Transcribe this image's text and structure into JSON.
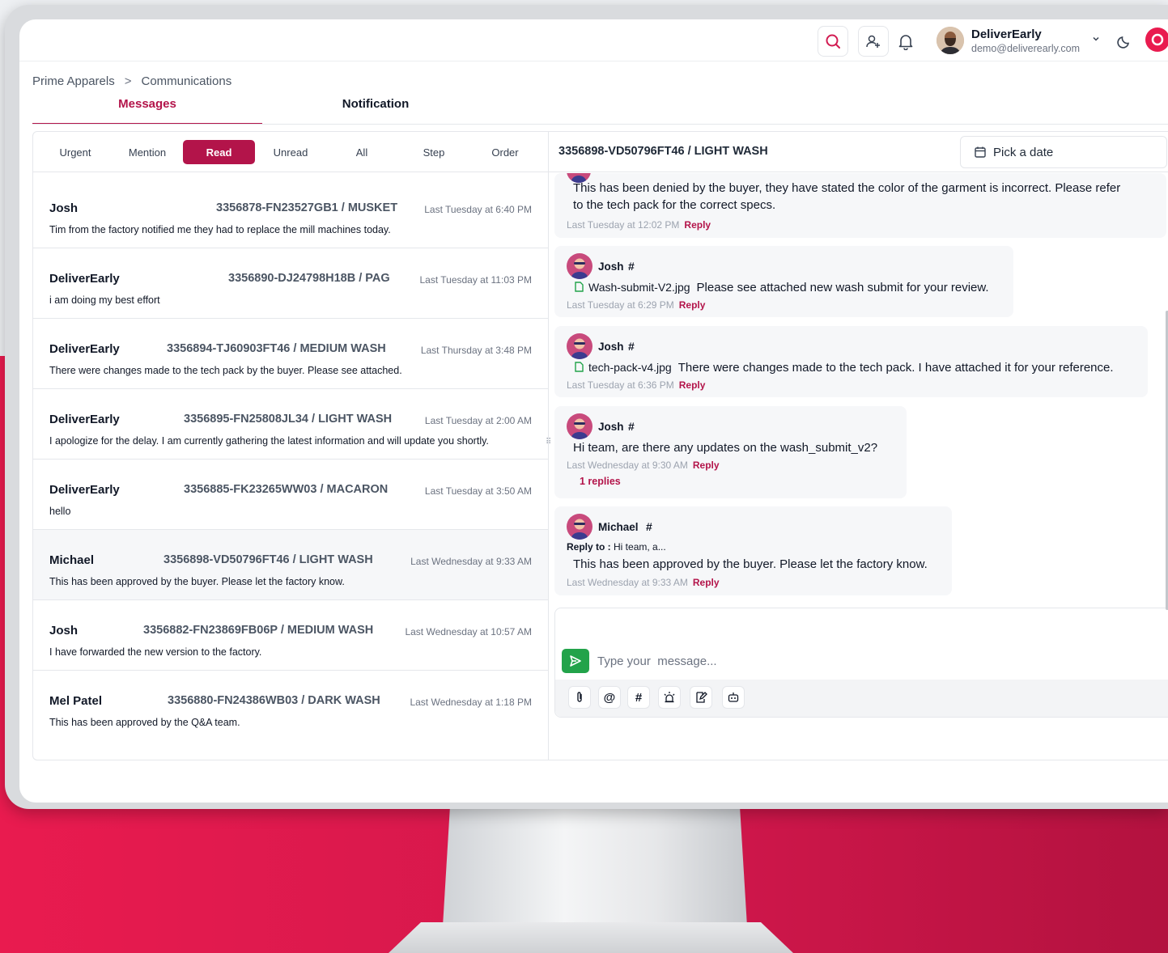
{
  "topbar": {
    "user_name": "DeliverEarly",
    "user_email": "demo@deliverearly.com"
  },
  "breadcrumb": {
    "items": [
      "Prime Apparels",
      "Communications"
    ],
    "separator": ">"
  },
  "tabs": [
    {
      "label": "Messages",
      "active": true
    },
    {
      "label": "Notification",
      "active": false
    }
  ],
  "filters": [
    {
      "label": "Urgent",
      "active": false
    },
    {
      "label": "Mention",
      "active": false
    },
    {
      "label": "Read",
      "active": true
    },
    {
      "label": "Unread",
      "active": false
    },
    {
      "label": "All",
      "active": false
    },
    {
      "label": "Step",
      "active": false
    },
    {
      "label": "Order",
      "active": false
    }
  ],
  "conversations": [
    {
      "name": "Josh",
      "order": "3356878-FN23527GB1 / MUSKET",
      "time": "Last Tuesday at 6:40 PM",
      "text": "Tim from the factory notified me they had to replace the mill machines today."
    },
    {
      "name": "DeliverEarly",
      "order": "3356890-DJ24798H18B / PAG",
      "time": "Last Tuesday at 11:03 PM",
      "text": "i am doing my best effort"
    },
    {
      "name": "DeliverEarly",
      "order": "3356894-TJ60903FT46 / MEDIUM WASH",
      "time": "Last Thursday at 3:48 PM",
      "text": "There were changes made to the tech pack by the buyer. Please see attached."
    },
    {
      "name": "DeliverEarly",
      "order": "3356895-FN25808JL34 / LIGHT WASH",
      "time": "Last Tuesday at 2:00 AM",
      "text": "I apologize for the delay. I am currently gathering the latest information and will update you shortly."
    },
    {
      "name": "DeliverEarly",
      "order": "3356885-FK23265WW03 / MACARON",
      "time": "Last Tuesday at 3:50 AM",
      "text": "hello"
    },
    {
      "name": "Michael",
      "order": "3356898-VD50796FT46 / LIGHT WASH",
      "time": "Last Wednesday at 9:33 AM",
      "text": "This has been approved by the buyer. Please let the factory know."
    },
    {
      "name": "Josh",
      "order": "3356882-FN23869FB06P / MEDIUM WASH",
      "time": "Last Wednesday at 10:57 AM",
      "text": "I have forwarded the new version to the factory."
    },
    {
      "name": "Mel Patel",
      "order": "3356880-FN24386WB03 / DARK WASH",
      "time": "Last Wednesday at 1:18 PM",
      "text": "This has been approved by the Q&A team."
    }
  ],
  "thread": {
    "title": "3356898-VD50796FT46 / LIGHT WASH",
    "date_placeholder": "Pick a date",
    "messages": [
      {
        "body_line1": "This has been denied by the buyer, they have stated the color of the garment is incorrect. Please refer",
        "body_line2": "to the tech pack for the correct specs.",
        "meta": "Last Tuesday at 12:02 PM",
        "reply": "Reply"
      },
      {
        "author": "Josh",
        "hash": "#",
        "file": "Wash-submit-V2.jpg",
        "body": "Please see attached new wash submit for your review.",
        "meta": "Last Tuesday at 6:29 PM",
        "reply": "Reply"
      },
      {
        "author": "Josh",
        "hash": "#",
        "file": "tech-pack-v4.jpg",
        "body": "There were changes made to the tech pack. I have attached it for your reference.",
        "meta": "Last Tuesday at 6:36 PM",
        "reply": "Reply"
      },
      {
        "author": "Josh",
        "hash": "#",
        "body": "Hi team, are there any updates on the wash_submit_v2?",
        "meta": "Last Wednesday at 9:30 AM",
        "reply": "Reply",
        "replies": "1 replies"
      },
      {
        "author": "Michael",
        "hash": "#",
        "reply_to_label": "Reply to :",
        "reply_to_text": "Hi team, a...",
        "body": "This has been approved by the buyer. Please let the factory know.",
        "meta": "Last Wednesday at 9:33 AM",
        "reply": "Reply"
      }
    ]
  },
  "composer": {
    "placeholder": "Type your  message..."
  },
  "toolbar": {
    "at_symbol": "@",
    "hash_symbol": "#"
  },
  "colors": {
    "accent": "#b3144a",
    "send": "#22a34a",
    "brand_red": "#e91b4f"
  }
}
